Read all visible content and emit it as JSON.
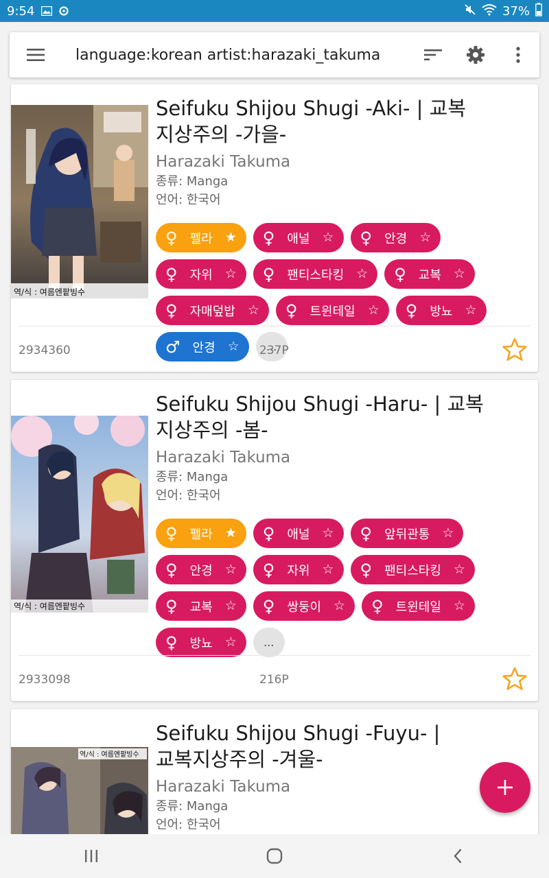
{
  "status_bar": {
    "time": "9:54",
    "battery": "37%"
  },
  "search": {
    "query": "language:korean artist:harazaki_takuma"
  },
  "labels": {
    "type_prefix": "종류: ",
    "lang_prefix": "언어: ",
    "more": "..."
  },
  "colors": {
    "status_bar": "#1a87c0",
    "female_tag": "#d81b60",
    "favorite_tag": "#f9a10e",
    "male_tag": "#1e74d0",
    "fab": "#d81b60",
    "star": "#f5a623"
  },
  "results": [
    {
      "title": "Seifuku Shijou Shugi -Aki- | 교복지상주의 -가을-",
      "title_line1": "Seifuku Shijou Shugi -Aki- | 교복",
      "title_line2": "지상주의 -가을-",
      "artist": "Harazaki Takuma",
      "type": "종류: Manga",
      "language": "언어: 한국어",
      "tags": [
        {
          "label": "펠라",
          "gender": "female",
          "favorite": true
        },
        {
          "label": "애널",
          "gender": "female",
          "favorite": false
        },
        {
          "label": "안경",
          "gender": "female",
          "favorite": false
        },
        {
          "label": "자위",
          "gender": "female",
          "favorite": false
        },
        {
          "label": "팬티스타킹",
          "gender": "female",
          "favorite": false
        },
        {
          "label": "교복",
          "gender": "female",
          "favorite": false
        },
        {
          "label": "자매덮밥",
          "gender": "female",
          "favorite": false
        },
        {
          "label": "트윈테일",
          "gender": "female",
          "favorite": false
        },
        {
          "label": "방뇨",
          "gender": "female",
          "favorite": false
        },
        {
          "label": "안경",
          "gender": "male",
          "favorite": false
        }
      ],
      "id": "2934360",
      "pages": "237P",
      "cover_caption": "역/식 : 여름엔팥빙수"
    },
    {
      "title": "Seifuku Shijou Shugi -Haru- | 교복지상주의 -봄-",
      "title_line1": "Seifuku Shijou Shugi -Haru- | 교복",
      "title_line2": "지상주의 -봄-",
      "artist": "Harazaki Takuma",
      "type": "종류: Manga",
      "language": "언어: 한국어",
      "tags": [
        {
          "label": "펠라",
          "gender": "female",
          "favorite": true
        },
        {
          "label": "애널",
          "gender": "female",
          "favorite": false
        },
        {
          "label": "앞뒤관통",
          "gender": "female",
          "favorite": false
        },
        {
          "label": "안경",
          "gender": "female",
          "favorite": false
        },
        {
          "label": "자위",
          "gender": "female",
          "favorite": false
        },
        {
          "label": "팬티스타킹",
          "gender": "female",
          "favorite": false
        },
        {
          "label": "교복",
          "gender": "female",
          "favorite": false
        },
        {
          "label": "쌍둥이",
          "gender": "female",
          "favorite": false
        },
        {
          "label": "트윈테일",
          "gender": "female",
          "favorite": false
        },
        {
          "label": "방뇨",
          "gender": "female",
          "favorite": false
        }
      ],
      "id": "2933098",
      "pages": "216P",
      "cover_caption": "역/식 : 여름엔팥빙수"
    },
    {
      "title": "Seifuku Shijou Shugi -Fuyu- | 교복지상주의 -겨울-",
      "title_line1": "Seifuku Shijou Shugi -Fuyu- |",
      "title_line2": "교복지상주의 -겨울-",
      "artist": "Harazaki Takuma",
      "type": "종류: Manga",
      "language": "언어: 한국어",
      "cover_caption": "역/식 : 여름엔팥빙수"
    }
  ],
  "icons": {
    "menu": "hamburger-icon",
    "sort": "sort-icon",
    "settings": "gear-icon",
    "more": "more-vert-icon",
    "female": "female-symbol-icon",
    "male": "male-symbol-icon",
    "star": "star-icon",
    "add": "plus-icon",
    "recents": "recents-icon",
    "home": "home-icon",
    "back": "back-icon"
  }
}
